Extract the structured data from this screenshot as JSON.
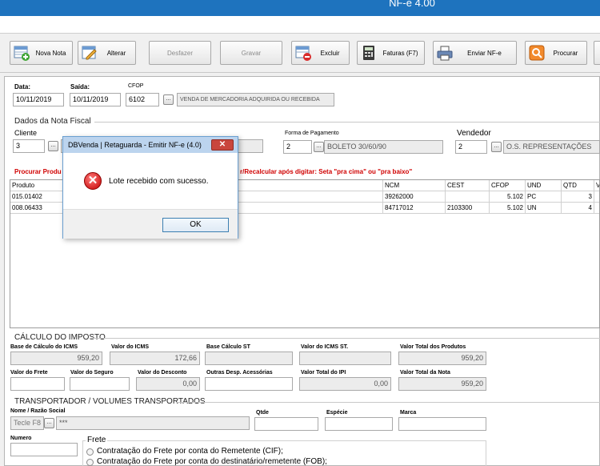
{
  "window": {
    "title": "NF-e 4.00"
  },
  "toolbar": {
    "new": "Nova Nota",
    "edit": "Alterar",
    "undo": "Desfazer",
    "save": "Gravar",
    "delete": "Excluir",
    "invoices": "Faturas (F7)",
    "send": "Enviar NF-e",
    "search": "Procurar"
  },
  "header": {
    "date_label": "Data:",
    "date_value": "10/11/2019",
    "exit_label": "Saída:",
    "exit_value": "10/11/2019",
    "cfop_label": "CFOP",
    "cfop_value": "6102",
    "cfop_desc": "VENDA DE MERCADORIA ADQUIRIDA OU RECEBIDA"
  },
  "fiscal": {
    "section": "Dados da Nota Fiscal",
    "client_label": "Cliente",
    "client_value": "3",
    "payment_label": "Forma de Pagamento",
    "payment_code": "2",
    "payment_desc": "BOLETO 30/60/90",
    "seller_label": "Vendedor",
    "seller_code": "2",
    "seller_desc": "O.S. REPRESENTAÇÕES"
  },
  "products": {
    "hint_left": "Procurar Produ",
    "hint_right": "r/Recalcular após digitar: Seta \"pra cima\" ou \"pra baixo\"",
    "columns": {
      "product": "Produto",
      "ncm": "NCM",
      "cest": "CEST",
      "cfop": "CFOP",
      "und": "UND",
      "qtd": "QTD",
      "v": "V"
    },
    "rows": [
      {
        "product": "015.01402",
        "ncm": "39262000",
        "cest": "",
        "cfop": "5.102",
        "und": "PC",
        "qtd": "3"
      },
      {
        "product": "008.06433",
        "ncm": "84717012",
        "cest": "2103300",
        "cfop": "5.102",
        "und": "UN",
        "qtd": "4"
      }
    ]
  },
  "tax": {
    "section": "CÁLCULO DO IMPOSTO",
    "base_icms_label": "Base de Cálculo do ICMS",
    "base_icms": "959,20",
    "icms_label": "Valor do ICMS",
    "icms": "172,66",
    "base_st_label": "Base Cálculo ST",
    "base_st": "",
    "icms_st_label": "Valor do ICMS ST.",
    "icms_st": "",
    "total_products_label": "Valor Total dos Produtos",
    "total_products": "959,20",
    "freight_label": "Valor do Frete",
    "freight": "",
    "insurance_label": "Valor do Seguro",
    "insurance": "",
    "discount_label": "Valor do Desconto",
    "discount": "0,00",
    "other_label": "Outras Desp. Acessórias",
    "other": "",
    "ipi_label": "Valor Total do IPI",
    "ipi": "0,00",
    "total_label": "Valor Total da Nota",
    "total": "959,20"
  },
  "transport": {
    "section": "TRANSPORTADOR / VOLUMES TRANSPORTADOS",
    "name_label": "Nome / Razão Social",
    "name_value": "Tecle F8",
    "name_extra": "***",
    "qty_label": "Qtde",
    "species_label": "Espécie",
    "brand_label": "Marca",
    "number_label": "Numero",
    "freight_group": "Frete",
    "freight_cif": "Contratação do Frete por conta do Remetente (CIF);",
    "freight_fob": "Contratação do Frete por conta do destinatário/remetente (FOB);"
  },
  "dialog": {
    "title": "DBVenda | Retaguarda - Emitir NF-e (4.0)",
    "close": "✕",
    "message": "Lote recebido com sucesso.",
    "ok": "OK"
  }
}
